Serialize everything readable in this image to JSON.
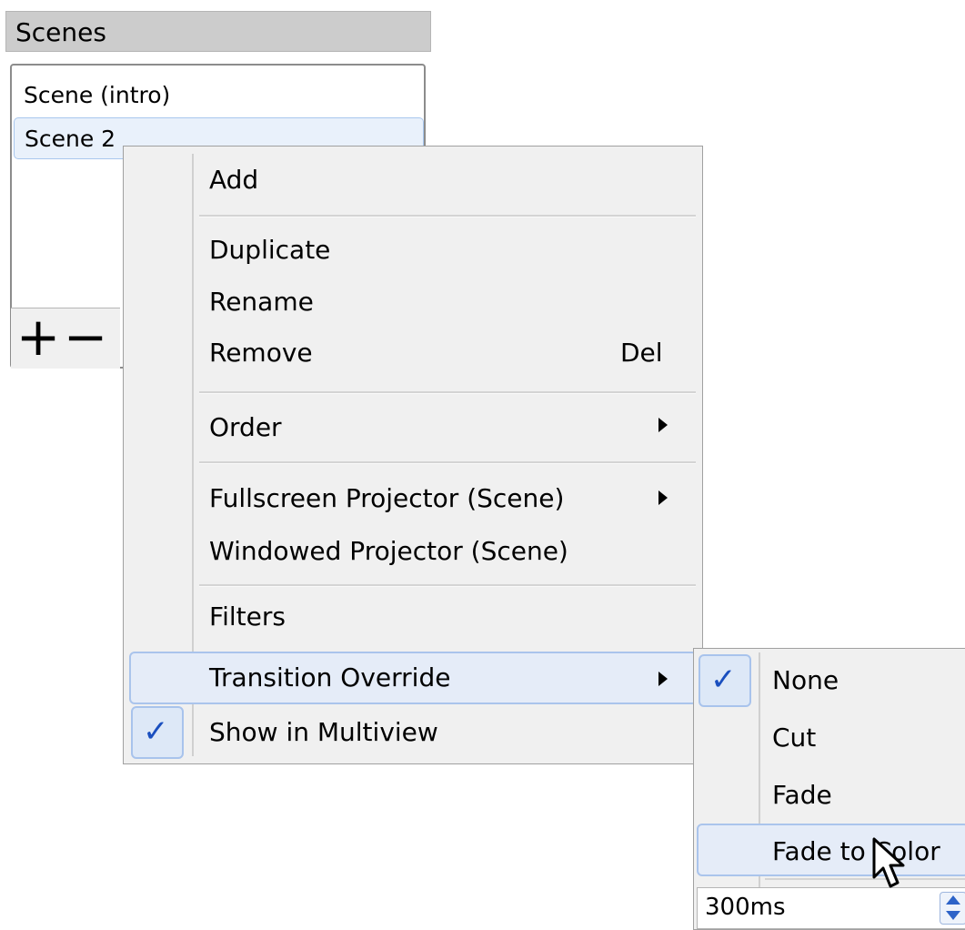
{
  "dock": {
    "title": "Scenes"
  },
  "scenes": {
    "items": [
      "Scene (intro)",
      "Scene 2"
    ],
    "selected": "Scene 2"
  },
  "toolbar": {
    "add_symbol": "+",
    "remove_symbol": "−"
  },
  "context_menu": {
    "add": "Add",
    "duplicate": "Duplicate",
    "rename": "Rename",
    "remove": "Remove",
    "remove_shortcut": "Del",
    "order": "Order",
    "fullscreen_projector": "Fullscreen Projector (Scene)",
    "windowed_projector": "Windowed Projector (Scene)",
    "filters": "Filters",
    "transition_override": "Transition Override",
    "show_in_multiview": "Show in Multiview",
    "checkmark": "✓"
  },
  "transition_submenu": {
    "none": "None",
    "cut": "Cut",
    "fade": "Fade",
    "fade_to_color": "Fade to Color",
    "duration": "300ms",
    "checkmark": "✓"
  },
  "colors": {
    "accent": "#1a4fbf",
    "highlight": "#e5ecf8",
    "highlight_border": "#aac4ec"
  },
  "icons": {
    "cursor": "arrow-pointer-icon",
    "submenu": "chevron-right-icon",
    "check": "checkmark-icon"
  }
}
